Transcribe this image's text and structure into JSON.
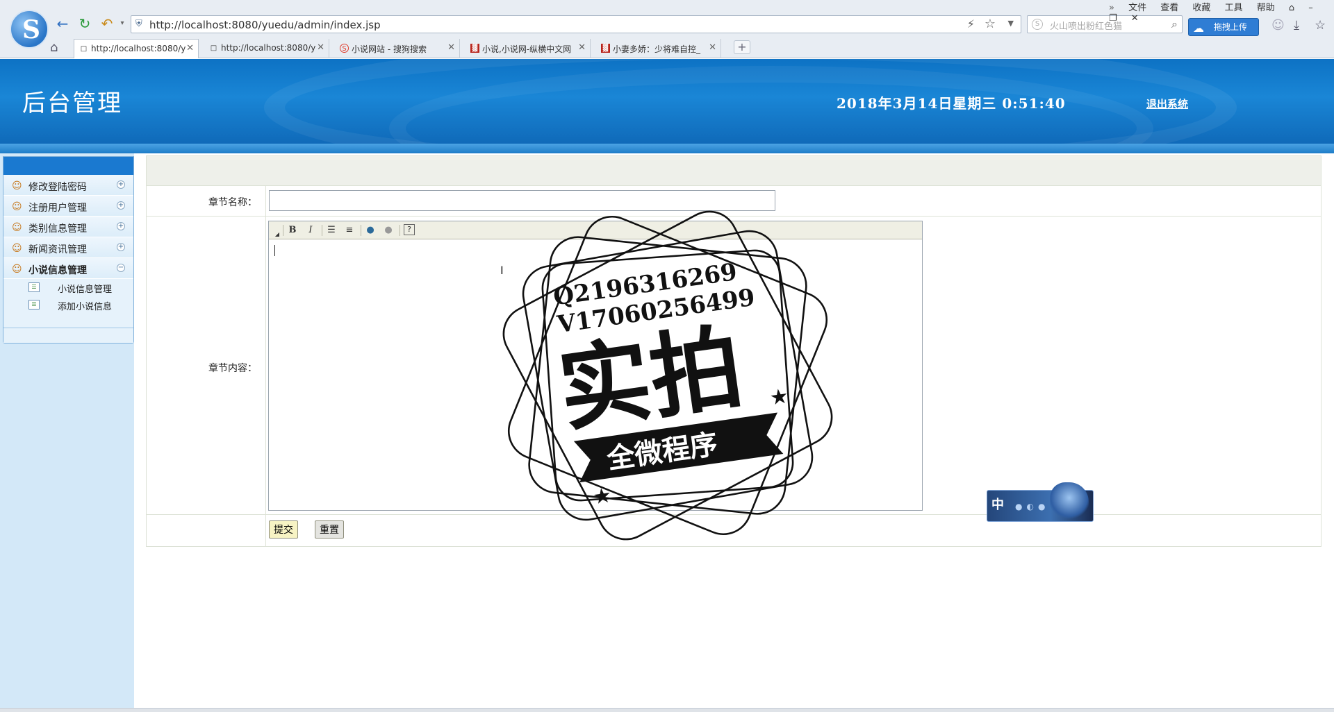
{
  "browser": {
    "menus": [
      "文件",
      "查看",
      "收藏",
      "工具",
      "帮助"
    ],
    "url": "http://localhost:8080/yuedu/admin/index.jsp",
    "search_placeholder": "火山喷出粉红色猫",
    "upload_label": "拖拽上传",
    "tabs": [
      {
        "title": "http://localhost:8080/y",
        "icon": "page-icon",
        "active": true
      },
      {
        "title": "http://localhost:8080/y",
        "icon": "page-icon",
        "active": false
      },
      {
        "title": "小说网站 - 搜狗搜索",
        "icon": "sogou-icon",
        "active": false
      },
      {
        "title": "小说,小说网-纵横中文网",
        "icon": "zongheng-icon",
        "active": false
      },
      {
        "title": "小妻多娇：少将难自控_",
        "icon": "zongheng-icon",
        "active": false
      }
    ]
  },
  "header": {
    "title": "后台管理",
    "datetime": "2018年3月14日星期三  0:51:40",
    "logout_label": "退出系统"
  },
  "sidebar": {
    "groups": [
      {
        "label": "修改登陆密码",
        "toggle": "+"
      },
      {
        "label": "注册用户管理",
        "toggle": "+"
      },
      {
        "label": "类别信息管理",
        "toggle": "+"
      },
      {
        "label": "新闻资讯管理",
        "toggle": "+"
      },
      {
        "label": "小说信息管理",
        "toggle": "−"
      }
    ],
    "items": [
      {
        "label": "小说信息管理"
      },
      {
        "label": "添加小说信息"
      }
    ]
  },
  "form": {
    "chapter_name_label": "章节名称：",
    "chapter_name_value": "",
    "chapter_content_label": "章节内容：",
    "chapter_content_value": "",
    "submit_label": "提交",
    "reset_label": "重置",
    "toolbar": [
      "bold-icon",
      "italic-icon",
      "ordered-list-icon",
      "unordered-list-icon",
      "link-icon",
      "unlink-icon",
      "help-icon"
    ]
  },
  "watermark": {
    "qq": "Q2196316269",
    "wechat": "V17060256499",
    "big_text": "实拍",
    "banner_text": "全微程序"
  },
  "ime": {
    "mode": "中"
  }
}
